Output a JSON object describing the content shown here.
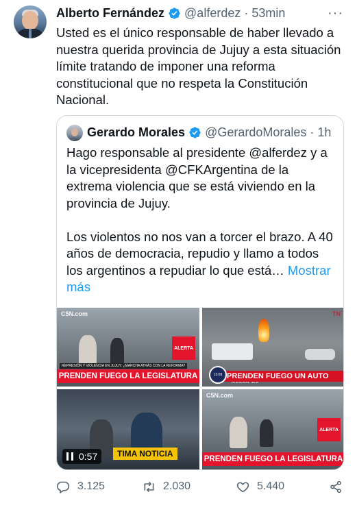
{
  "tweet": {
    "author_name": "Alberto Fernández",
    "handle": "@alferdez",
    "separator": "·",
    "time": "53min",
    "more_label": "···",
    "text": "Usted es el único responsable de haber llevado a nuestra querida provincia de Jujuy a esta situación límite tratando de imponer una reforma constitucional que no respeta la Constitución Nacional."
  },
  "quoted": {
    "author_name": "Gerardo Morales",
    "handle": "@GerardoMorales",
    "separator": "·",
    "time": "1h",
    "paragraph1": "Hago responsable al presidente @alferdez y a la vicepresidenta @CFKArgentina de la extrema violencia que se está viviendo en la provincia de Jujuy.",
    "paragraph2": "Los violentos no nos van a torcer el brazo. A 40 años de democracia, repudio y llamo a todos los argentinos a repudiar lo que está…",
    "show_more": "Mostrar más",
    "media": [
      {
        "logo": "C5N.com",
        "alert": "ALERTA",
        "subline": "REPRESIÓN Y VIOLENCIA EN JUJUY: ¿MARCHA ATRÁS CON LA REFORMA?",
        "banner": "PRENDEN FUEGO LA LEGISLATURA"
      },
      {
        "logo": "TN",
        "clock": "12:09",
        "subline": "ATENCIÓN TELE",
        "banner": "PRENDEN FUEGO UN AUTO"
      },
      {
        "timestamp": "0:57",
        "banner": "TIMA NOTICIA",
        "subline": "ÚLTIMA NOTICIA"
      },
      {
        "logo": "C5N.com",
        "alert": "ALERTA",
        "banner": "PRENDEN FUEGO LA LEGISLATURA"
      }
    ]
  },
  "actions": {
    "replies": "3.125",
    "retweets": "2.030",
    "likes": "5.440"
  },
  "colors": {
    "text": "#0f1419",
    "muted": "#536471",
    "link": "#1d9bf0",
    "verified": "#1d9bf0",
    "banner_red": "#e3142c"
  },
  "icons": [
    "verified-badge-icon",
    "more-icon",
    "reply-icon",
    "retweet-icon",
    "like-icon",
    "share-icon",
    "pause-icon"
  ]
}
